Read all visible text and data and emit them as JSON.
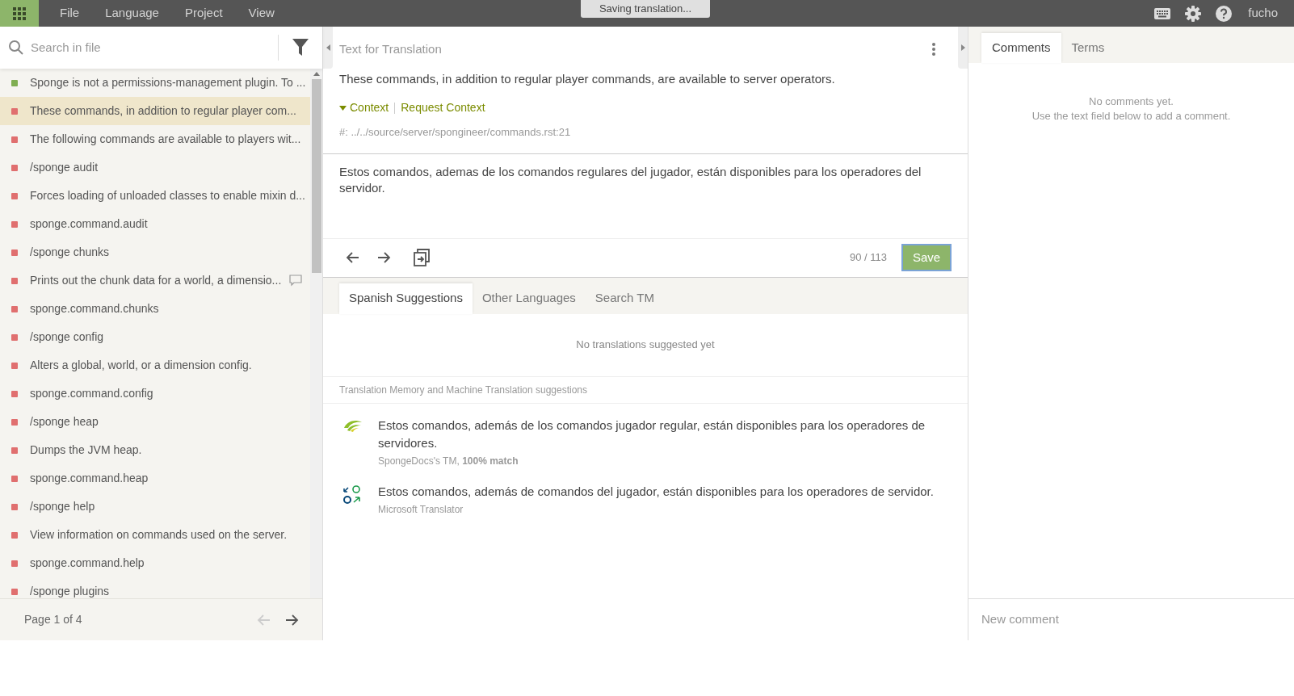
{
  "menu": [
    "File",
    "Language",
    "Project",
    "View"
  ],
  "notice": "Saving translation...",
  "user": "fucho",
  "search": {
    "placeholder": "Search in file"
  },
  "entries": [
    {
      "text": "Sponge is not a permissions-management plugin. To ...",
      "color": "#7fae52",
      "selected": false,
      "has_comment": false
    },
    {
      "text": "These commands, in addition to regular player com...",
      "color": "#e06f6f",
      "selected": true,
      "has_comment": false
    },
    {
      "text": "The following commands are available to players wit...",
      "color": "#e06f6f",
      "selected": false,
      "has_comment": false
    },
    {
      "text": "/sponge audit",
      "color": "#e06f6f",
      "selected": false,
      "has_comment": false
    },
    {
      "text": "Forces loading of unloaded classes to enable mixin d...",
      "color": "#e06f6f",
      "selected": false,
      "has_comment": false
    },
    {
      "text": "sponge.command.audit",
      "color": "#e06f6f",
      "selected": false,
      "has_comment": false
    },
    {
      "text": "/sponge chunks",
      "color": "#e06f6f",
      "selected": false,
      "has_comment": false
    },
    {
      "text": "Prints out the chunk data for a world, a dimensio...",
      "color": "#e06f6f",
      "selected": false,
      "has_comment": true
    },
    {
      "text": "sponge.command.chunks",
      "color": "#e06f6f",
      "selected": false,
      "has_comment": false
    },
    {
      "text": "/sponge config",
      "color": "#e06f6f",
      "selected": false,
      "has_comment": false
    },
    {
      "text": "Alters a global, world, or a dimension config.",
      "color": "#e06f6f",
      "selected": false,
      "has_comment": false
    },
    {
      "text": "sponge.command.config",
      "color": "#e06f6f",
      "selected": false,
      "has_comment": false
    },
    {
      "text": "/sponge heap",
      "color": "#e06f6f",
      "selected": false,
      "has_comment": false
    },
    {
      "text": "Dumps the JVM heap.",
      "color": "#e06f6f",
      "selected": false,
      "has_comment": false
    },
    {
      "text": "sponge.command.heap",
      "color": "#e06f6f",
      "selected": false,
      "has_comment": false
    },
    {
      "text": "/sponge help",
      "color": "#e06f6f",
      "selected": false,
      "has_comment": false
    },
    {
      "text": "View information on commands used on the server.",
      "color": "#e06f6f",
      "selected": false,
      "has_comment": false
    },
    {
      "text": "sponge.command.help",
      "color": "#e06f6f",
      "selected": false,
      "has_comment": false
    },
    {
      "text": "/sponge plugins",
      "color": "#e06f6f",
      "selected": false,
      "has_comment": false
    }
  ],
  "pager": {
    "label": "Page 1 of 4",
    "prev_disabled": true,
    "next_disabled": false
  },
  "source": {
    "heading": "Text for Translation",
    "text": "These commands, in addition to regular player commands, are available to server operators.",
    "context_label": "Context",
    "context_expanded": true,
    "request_context": "Request Context",
    "location": "#: ../../source/server/spongineer/commands.rst:21"
  },
  "translation": {
    "value": "Estos comandos, ademas de los comandos regulares del jugador, están disponibles para los operadores del servidor.",
    "counter": "90 / 113",
    "save": "Save"
  },
  "suggestion_tabs": [
    {
      "label": "Spanish Suggestions",
      "selected": true
    },
    {
      "label": "Other Languages",
      "selected": false
    },
    {
      "label": "Search TM",
      "selected": false
    }
  ],
  "no_suggestions": "No translations suggested yet",
  "tm_heading": "Translation Memory and Machine Translation suggestions",
  "tm_suggestions": [
    {
      "kind": "memory",
      "text": "Estos comandos, además de los comandos jugador regular, están disponibles para los operadores de servidores.",
      "source": "SpongeDocs's TM, **100% match**"
    },
    {
      "kind": "machine",
      "text": "Estos comandos, además de comandos del jugador, están disponibles para los operadores de servidor.",
      "source": "Microsoft Translator"
    }
  ],
  "side_tabs": [
    {
      "label": "Comments",
      "selected": true
    },
    {
      "label": "Terms",
      "selected": false
    }
  ],
  "comments_empty": [
    "No comments yet.",
    "Use the text field below to add a comment."
  ],
  "comment_field": {
    "placeholder": "New comment"
  }
}
